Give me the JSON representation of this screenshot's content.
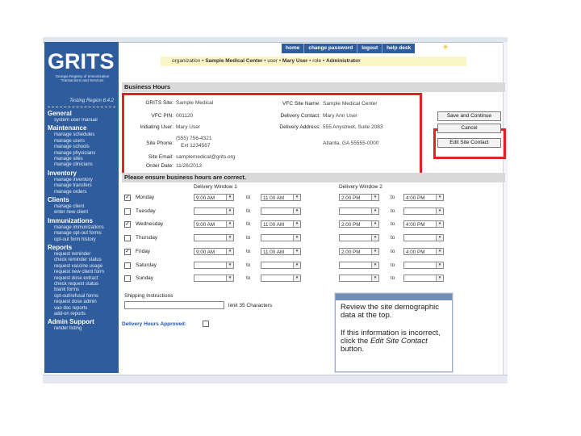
{
  "header": {
    "logo_text": "GRITS",
    "registry_line": "Georgia Registry of Immunization Transactions and Services",
    "region": "Testing Region 8.4.2",
    "nav": [
      "home",
      "change password",
      "logout",
      "help desk"
    ],
    "context": {
      "org_label": "organization",
      "org_value": "Sample Medical Center",
      "user_label": "user",
      "user_value": "Mary User",
      "role_label": "role",
      "role_value": "Administrator"
    }
  },
  "sidebar": {
    "sections": [
      {
        "title": "General",
        "items": [
          "system user manual"
        ]
      },
      {
        "title": "Maintenance",
        "items": [
          "manage schedules",
          "manage users",
          "manage schools",
          "manage physicians",
          "manage sites",
          "manage clinicians"
        ]
      },
      {
        "title": "Inventory",
        "items": [
          "manage inventory",
          "manage transfers",
          "manage orders"
        ]
      },
      {
        "title": "Clients",
        "items": [
          "manage client",
          "enter new client"
        ]
      },
      {
        "title": "Immunizations",
        "items": [
          "manage immunizations",
          "manage opt-out forms",
          "opt-out form history"
        ]
      },
      {
        "title": "Reports",
        "items": [
          "request reminder",
          "check reminder status",
          "request vaccine usage",
          "request new client form",
          "request dose extract",
          "check request status",
          "blank forms",
          "opt-out/refusal forms",
          "request dose admin",
          "vao doc reports",
          "add-on reports"
        ]
      },
      {
        "title": "Admin Support",
        "items": [
          "render listing"
        ]
      }
    ]
  },
  "main": {
    "section_title": "Business Hours",
    "site": {
      "site_label": "GRITS Site:",
      "site_value": "Sample Medical",
      "vfc_label": "VFC PIN:",
      "vfc_value": "001120",
      "initiating_label": "Initiating User:",
      "initiating_value": "Mary User",
      "phone_label": "Site Phone:",
      "phone_value": "(555) 756-4321",
      "phone_ext": "Ext 1234567",
      "email_label": "Site Email:",
      "email_value": "samplemedical@grits.org",
      "order_label": "Order Date:",
      "order_value": "11/26/2013",
      "vfc_name_label": "VFC Site Name:",
      "vfc_name_value": "Sample Medical Center",
      "contact_label": "Delivery Contact:",
      "contact_value": "Mary Ann User",
      "address_label": "Delivery Address:",
      "address_line1": "555 Anystreet, Suite 2083",
      "address_line2": "Atlanta, GA 55555-0000"
    },
    "buttons": {
      "save": "Save and Continue",
      "cancel": "Cancel",
      "edit": "Edit Site Contact"
    },
    "hours_banner": "Please ensure business hours are correct.",
    "window1_label": "Delivery Window 1",
    "window2_label": "Delivery Window 2",
    "to_label": "to",
    "days": [
      {
        "name": "Monday",
        "checked": true,
        "w1_start": "9:00 AM",
        "w1_end": "11:00 AM",
        "w2_start": "2:00 PM",
        "w2_end": "4:00 PM"
      },
      {
        "name": "Tuesday",
        "checked": false,
        "w1_start": "",
        "w1_end": "",
        "w2_start": "",
        "w2_end": ""
      },
      {
        "name": "Wednesday",
        "checked": true,
        "w1_start": "9:00 AM",
        "w1_end": "11:00 AM",
        "w2_start": "2:00 PM",
        "w2_end": "4:00 PM"
      },
      {
        "name": "Thursday",
        "checked": false,
        "w1_start": "",
        "w1_end": "",
        "w2_start": "",
        "w2_end": ""
      },
      {
        "name": "Friday",
        "checked": true,
        "w1_start": "9:00 AM",
        "w1_end": "11:00 AM",
        "w2_start": "2:00 PM",
        "w2_end": "4:00 PM"
      },
      {
        "name": "Saturday",
        "checked": false,
        "w1_start": "",
        "w1_end": "",
        "w2_start": "",
        "w2_end": ""
      },
      {
        "name": "Sunday",
        "checked": false,
        "w1_start": "",
        "w1_end": "",
        "w2_start": "",
        "w2_end": ""
      }
    ],
    "shipping_label": "Shipping Instructions",
    "shipping_value": "",
    "limit_text": "limit 35 Characters",
    "approved_label": "Delivery Hours Approved:"
  },
  "callout": {
    "line1": "Review the site demographic data at the top.",
    "line2_prefix": "If this information is incorrect, click the ",
    "line2_em": "Edit Site Contact",
    "line2_suffix": " button."
  },
  "colors": {
    "sidebar_blue": "#2f5c9c",
    "highlight_red": "#e02424",
    "context_yellow": "#fbf6c8",
    "link_blue": "#1f4fb5"
  }
}
